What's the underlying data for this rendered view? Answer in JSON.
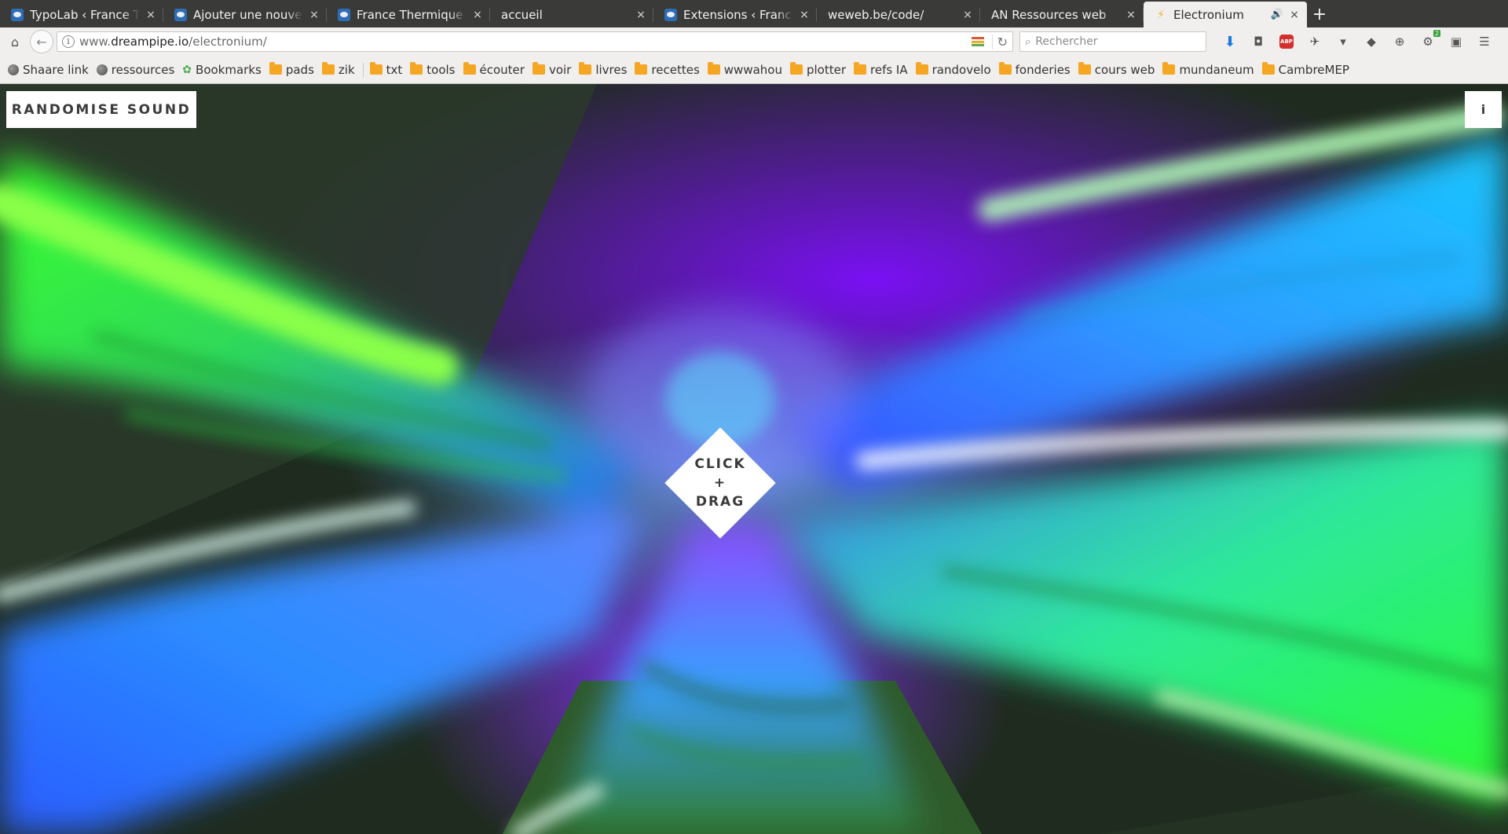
{
  "browser": {
    "tabs": [
      {
        "title": "TypoLab ‹ France Therm",
        "favicon": "wordpress-icon"
      },
      {
        "title": "Ajouter une nouvelle c",
        "favicon": "wordpress-icon"
      },
      {
        "title": "France Thermique – Un",
        "favicon": "wordpress-icon"
      },
      {
        "title": "accueil",
        "favicon": "none"
      },
      {
        "title": "Extensions ‹ France Th",
        "favicon": "wordpress-icon"
      },
      {
        "title": "weweb.be/code/",
        "favicon": "none"
      },
      {
        "title": "AN Ressources web",
        "favicon": "none"
      },
      {
        "title": "Electronium",
        "favicon": "bolt-icon",
        "active": true,
        "audio": true
      }
    ],
    "close_glyph": "×",
    "new_tab_glyph": "+",
    "url": {
      "prefix": "www.",
      "host": "dreampipe.io",
      "path": "/electronium/"
    },
    "search_placeholder": "Rechercher",
    "extension_badge": "2",
    "abp_label": "ABP",
    "bookmarks": [
      {
        "label": "Shaare link",
        "icon": "globe-icon"
      },
      {
        "label": "ressources",
        "icon": "globe-icon"
      },
      {
        "label": "Bookmarks",
        "icon": "star-icon"
      },
      {
        "label": "pads",
        "icon": "folder-icon"
      },
      {
        "label": "zik",
        "icon": "folder-icon"
      },
      {
        "label": "txt",
        "icon": "folder-icon"
      },
      {
        "label": "tools",
        "icon": "folder-icon"
      },
      {
        "label": "écouter",
        "icon": "folder-icon"
      },
      {
        "label": "voir",
        "icon": "folder-icon"
      },
      {
        "label": "livres",
        "icon": "folder-icon"
      },
      {
        "label": "recettes",
        "icon": "folder-icon"
      },
      {
        "label": "wwwahou",
        "icon": "folder-icon"
      },
      {
        "label": "plotter",
        "icon": "folder-icon"
      },
      {
        "label": "refs IA",
        "icon": "folder-icon"
      },
      {
        "label": "randovelo",
        "icon": "folder-icon"
      },
      {
        "label": "fonderies",
        "icon": "folder-icon"
      },
      {
        "label": "cours web",
        "icon": "folder-icon"
      },
      {
        "label": "mundaneum",
        "icon": "folder-icon"
      },
      {
        "label": "CambreMEP",
        "icon": "folder-icon"
      }
    ]
  },
  "page": {
    "randomise_label": "RANDOMISE SOUND",
    "info_label": "i",
    "center_label": [
      "CLICK",
      "+",
      "DRAG"
    ]
  },
  "colors": {
    "tab_strip": "#3a3a38",
    "toolbar": "#f0efed",
    "visual_violet": "#7a10f4",
    "visual_blue": "#2a4dff",
    "visual_green": "#3cff3c",
    "visual_dark": "#1f2b1f"
  }
}
